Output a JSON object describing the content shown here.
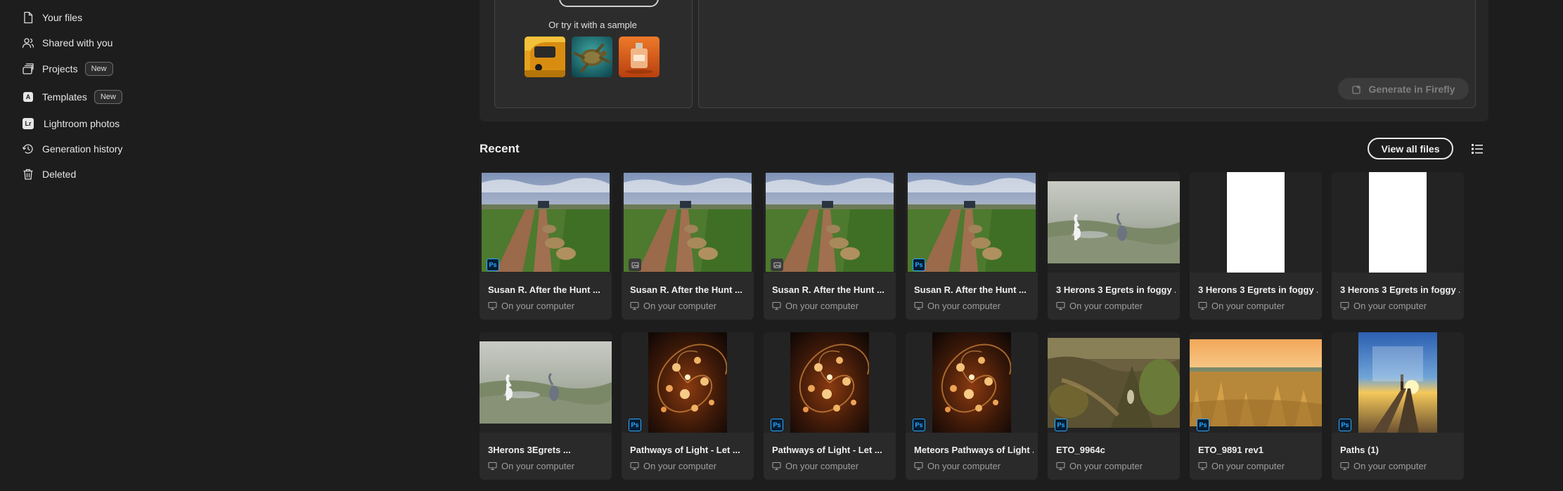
{
  "sidebar": {
    "items": [
      {
        "label": "Your files",
        "icon": "file-icon"
      },
      {
        "label": "Shared with you",
        "icon": "people-icon"
      },
      {
        "label": "Projects",
        "icon": "projects-icon",
        "badge": "New"
      },
      {
        "label": "Templates",
        "icon": "templates-icon",
        "badge": "New"
      },
      {
        "label": "Lightroom photos",
        "icon": "lightroom-icon",
        "icon_text": "Lr"
      },
      {
        "label": "Generation history",
        "icon": "history-icon"
      },
      {
        "label": "Deleted",
        "icon": "trash-icon"
      }
    ]
  },
  "sample": {
    "label": "Or try it with a sample",
    "thumbs": [
      "yellow-car",
      "sea-turtle",
      "perfume-bottle"
    ]
  },
  "prompt": {
    "generate_label": "Generate in Firefly"
  },
  "recent": {
    "title": "Recent",
    "view_all_label": "View all files",
    "location_text": "On your computer",
    "cards": [
      {
        "name": "Susan R. After the Hunt ...",
        "badge": "Ps",
        "thumb": "lions"
      },
      {
        "name": "Susan R. After the Hunt ...",
        "badge": "generic",
        "thumb": "lions"
      },
      {
        "name": "Susan R. After the Hunt ...",
        "badge": "generic",
        "thumb": "lions"
      },
      {
        "name": "Susan R. After the Hunt ...",
        "badge": "Ps",
        "thumb": "lions"
      },
      {
        "name": "3 Herons 3 Egrets in foggy ...",
        "badge": "",
        "thumb": "herons"
      },
      {
        "name": "3 Herons 3 Egrets in foggy ...",
        "badge": "",
        "thumb": "white"
      },
      {
        "name": "3 Herons 3 Egrets in foggy ...",
        "badge": "",
        "thumb": "white"
      },
      {
        "name": "3Herons 3Egrets ...",
        "badge": "",
        "thumb": "herons"
      },
      {
        "name": "Pathways of Light - Let ...",
        "badge": "Ps",
        "thumb": "spiral"
      },
      {
        "name": "Pathways of Light - Let ...",
        "badge": "Ps",
        "thumb": "spiral"
      },
      {
        "name": "Meteors Pathways of Light ...",
        "badge": "Ps",
        "thumb": "spiral"
      },
      {
        "name": "ETO_9964c",
        "badge": "Ps",
        "thumb": "bushes"
      },
      {
        "name": "ETO_9891 rev1",
        "badge": "Ps",
        "thumb": "grassland"
      },
      {
        "name": "Paths (1)",
        "badge": "Ps",
        "thumb": "pier"
      }
    ]
  },
  "colors": {
    "background": "#1d1d1d",
    "ps_badge": "#001e36",
    "ps_text": "#31a8ff"
  }
}
